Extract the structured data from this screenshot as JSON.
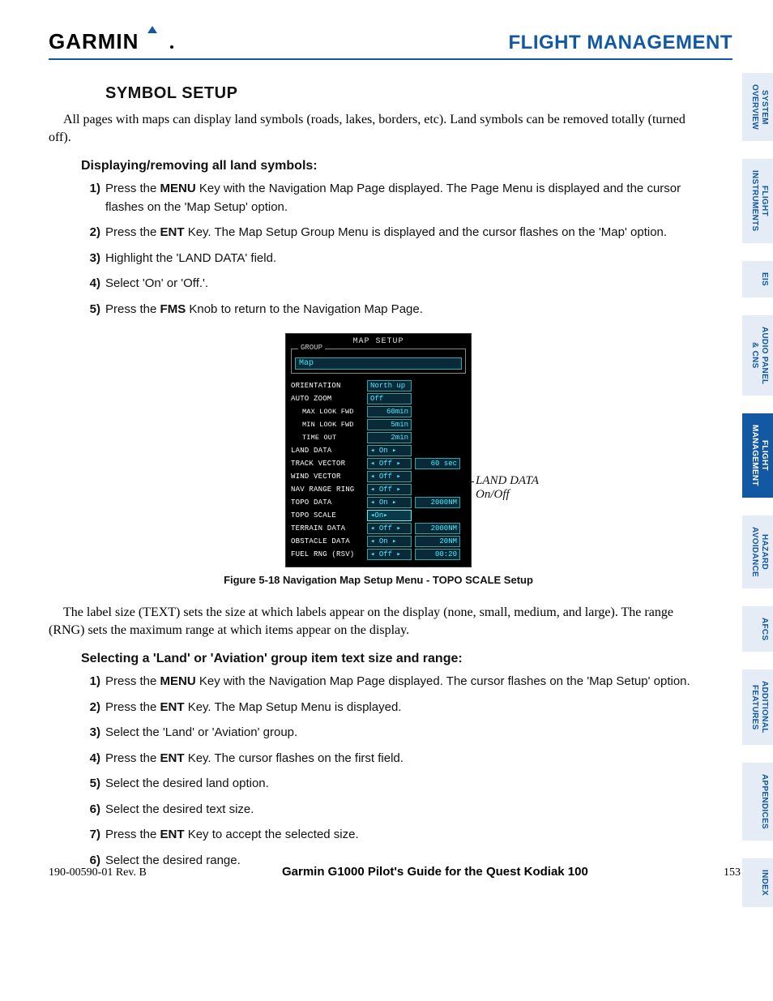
{
  "brand": "GARMIN",
  "header": {
    "title": "FLIGHT MANAGEMENT"
  },
  "section": {
    "title": "SYMBOL SETUP",
    "intro": "All pages with maps can display land symbols (roads, lakes, borders, etc).  Land symbols can be removed totally (turned off).",
    "sub1": "Displaying/removing all land symbols:",
    "steps1": [
      {
        "n": "1)",
        "pre": "Press the ",
        "b": "MENU",
        "post": " Key with the Navigation Map Page displayed.  The Page Menu is displayed and the cursor flashes on the 'Map Setup' option."
      },
      {
        "n": "2)",
        "pre": "Press the ",
        "b": "ENT",
        "post": " Key.  The Map Setup Group Menu is displayed and the cursor flashes on the 'Map' option."
      },
      {
        "n": "3)",
        "pre": "Highlight the 'LAND DATA' field.",
        "b": "",
        "post": ""
      },
      {
        "n": "4)",
        "pre": "Select 'On' or 'Off.'.",
        "b": "",
        "post": ""
      },
      {
        "n": "5)",
        "pre": "Press the ",
        "b": "FMS",
        "post": " Knob to return to the Navigation Map Page."
      }
    ],
    "body2": "The label size (TEXT) sets the size at which labels appear on the display (none, small, medium, and large).  The range (RNG) sets the maximum range at which items appear on the display.",
    "sub2": "Selecting a 'Land' or 'Aviation' group item text size and range:",
    "steps2": [
      {
        "n": "1)",
        "pre": "Press the ",
        "b": "MENU",
        "post": " Key with the Navigation Map Page displayed.  The cursor flashes on the 'Map Setup' option."
      },
      {
        "n": "2)",
        "pre": "Press the ",
        "b": "ENT",
        "post": " Key.  The Map Setup Menu is displayed."
      },
      {
        "n": "3)",
        "pre": "Select the 'Land'  or 'Aviation' group.",
        "b": "",
        "post": ""
      },
      {
        "n": "4)",
        "pre": "Press the ",
        "b": "ENT",
        "post": " Key.  The cursor flashes on the first field."
      },
      {
        "n": "5)",
        "pre": "Select the desired land option.",
        "b": "",
        "post": ""
      },
      {
        "n": "6)",
        "pre": "Select the desired text size.",
        "b": "",
        "post": ""
      },
      {
        "n": "7)",
        "pre": "Press the ",
        "b": "ENT",
        "post": " Key to accept the selected size."
      },
      {
        "n": "6)",
        "pre": "Select the desired range.",
        "b": "",
        "post": ""
      }
    ]
  },
  "figure": {
    "title": "MAP SETUP",
    "group_label": "GROUP",
    "group_value": "Map",
    "rows": [
      {
        "label": "ORIENTATION",
        "indent": false,
        "v1": "North up",
        "v1align": "left"
      },
      {
        "label": "AUTO ZOOM",
        "indent": false,
        "v1": "Off",
        "v1align": "left"
      },
      {
        "label": "MAX LOOK FWD",
        "indent": true,
        "v1": "60min",
        "v1align": "right"
      },
      {
        "label": "MIN LOOK FWD",
        "indent": true,
        "v1": "5min",
        "v1align": "right"
      },
      {
        "label": "TIME OUT",
        "indent": true,
        "v1": "2min",
        "v1align": "right"
      },
      {
        "label": "LAND DATA",
        "indent": false,
        "v1": "◂ On ▸",
        "v1align": "left"
      },
      {
        "label": "TRACK VECTOR",
        "indent": false,
        "v1": "◂ Off ▸",
        "v1align": "left",
        "v2": "60 sec"
      },
      {
        "label": "WIND VECTOR",
        "indent": false,
        "v1": "◂ Off ▸",
        "v1align": "left"
      },
      {
        "label": "NAV RANGE RING",
        "indent": false,
        "v1": "◂ Off ▸",
        "v1align": "left"
      },
      {
        "label": "TOPO DATA",
        "indent": false,
        "v1": "◂ On ▸",
        "v1align": "left",
        "v2": "2000NM"
      },
      {
        "label": "TOPO SCALE",
        "indent": false,
        "v1": "◂On▸",
        "v1align": "left",
        "selected": true
      },
      {
        "label": "TERRAIN DATA",
        "indent": false,
        "v1": "◂ Off ▸",
        "v1align": "left",
        "v2": "2000NM"
      },
      {
        "label": "OBSTACLE DATA",
        "indent": false,
        "v1": "◂ On ▸",
        "v1align": "left",
        "v2": "20NM"
      },
      {
        "label": "FUEL RNG (RSV)",
        "indent": false,
        "v1": "◂ Off ▸",
        "v1align": "left",
        "v2": "00:20"
      }
    ],
    "callout": "LAND DATA\nOn/Off",
    "caption": "Figure 5-18  Navigation Map Setup Menu - TOPO SCALE Setup"
  },
  "sidebar": [
    {
      "label": "SYSTEM\nOVERVIEW",
      "active": false
    },
    {
      "label": "FLIGHT\nINSTRUMENTS",
      "active": false
    },
    {
      "label": "EIS",
      "active": false
    },
    {
      "label": "AUDIO PANEL\n& CNS",
      "active": false
    },
    {
      "label": "FLIGHT\nMANAGEMENT",
      "active": true
    },
    {
      "label": "HAZARD\nAVOIDANCE",
      "active": false
    },
    {
      "label": "AFCS",
      "active": false
    },
    {
      "label": "ADDITIONAL\nFEATURES",
      "active": false
    },
    {
      "label": "APPENDICES",
      "active": false
    },
    {
      "label": "INDEX",
      "active": false
    }
  ],
  "footer": {
    "rev": "190-00590-01  Rev. B",
    "guide": "Garmin G1000 Pilot's Guide for the Quest Kodiak 100",
    "page": "153"
  }
}
